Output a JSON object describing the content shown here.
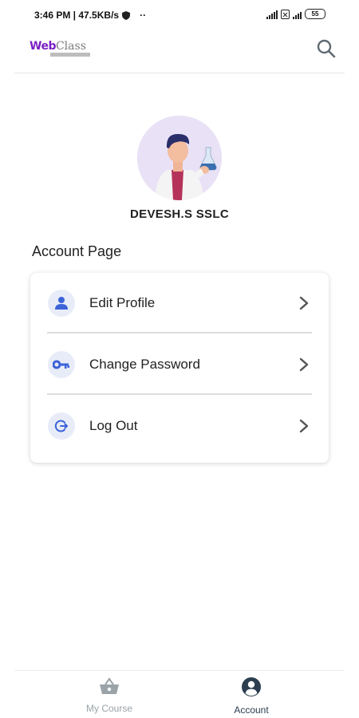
{
  "status": {
    "time_speed": "3:46 PM | 47.5KB/s",
    "extra": "··",
    "battery": "55"
  },
  "header": {
    "logo_web": "Web",
    "logo_class": "Class",
    "search_icon": "search-icon"
  },
  "profile": {
    "username": "DEVESH.S SSLC"
  },
  "page": {
    "title": "Account Page"
  },
  "menu": {
    "items": [
      {
        "label": "Edit Profile",
        "icon": "person-icon"
      },
      {
        "label": "Change Password",
        "icon": "key-icon"
      },
      {
        "label": "Log Out",
        "icon": "logout-icon"
      }
    ]
  },
  "bottom_nav": {
    "items": [
      {
        "label": "My Course",
        "icon": "basket-icon",
        "active": false
      },
      {
        "label": "Account",
        "icon": "account-icon",
        "active": true
      }
    ]
  },
  "colors": {
    "brand_purple": "#7c1fc4",
    "icon_blue": "#3d63d8",
    "icon_bg": "#e7ecf8",
    "nav_inactive": "#9aa3a8",
    "nav_active": "#2c3e50"
  }
}
